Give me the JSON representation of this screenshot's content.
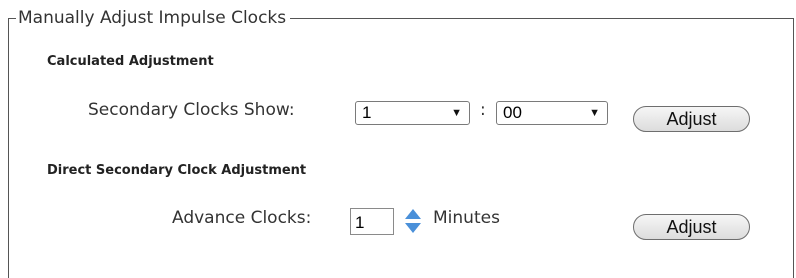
{
  "panel": {
    "legend": "Manually Adjust Impulse Clocks"
  },
  "calculated": {
    "title": "Calculated Adjustment",
    "label": "Secondary Clocks Show:",
    "hour_value": "1",
    "separator": ":",
    "minute_value": "00",
    "button_label": "Adjust"
  },
  "direct": {
    "title": "Direct Secondary Clock Adjustment",
    "label": "Advance Clocks:",
    "value": "1",
    "unit": "Minutes",
    "button_label": "Adjust"
  },
  "icons": {
    "dropdown": "triangle-down-icon",
    "spinner_up": "arrow-up-icon",
    "spinner_down": "arrow-down-icon"
  },
  "colors": {
    "spinner_arrow": "#4a90d9"
  }
}
